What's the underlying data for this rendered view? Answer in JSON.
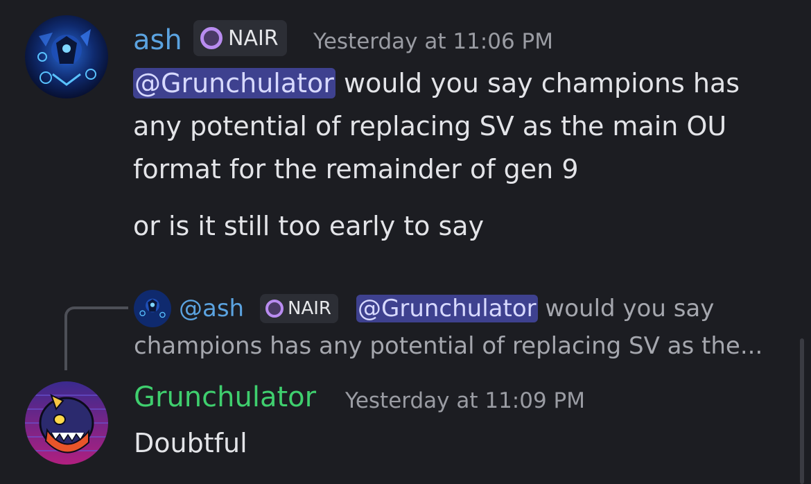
{
  "messages": [
    {
      "author": "ash",
      "tag": "NAIR",
      "timestamp": "Yesterday at 11:06 PM",
      "mention": "@Grunchulator",
      "line1_rest": " would you say champions has",
      "line2": "any potential of replacing SV as the main OU",
      "line3": "format for the remainder of gen 9",
      "followup": "or is it still too early to say"
    },
    {
      "author": "Grunchulator",
      "timestamp": "Yesterday at 11:09 PM",
      "body": "Doubtful",
      "reply": {
        "author": "@ash",
        "tag": "NAIR",
        "mention": "@Grunchulator",
        "line1_rest": " would you say",
        "line2": "champions has any potential of replacing SV as the..."
      }
    }
  ],
  "colors": {
    "background": "#1c1d22",
    "ash_name": "#5ba3e0",
    "grunchulator_name": "#3fcf6e",
    "mention_bg": "#3e418f",
    "tag_moon": "#b98cf0"
  },
  "icons": {
    "ash_avatar": "avatar-ash",
    "grunchulator_avatar": "avatar-grunchulator",
    "tag_icon": "crescent-moon-icon"
  }
}
